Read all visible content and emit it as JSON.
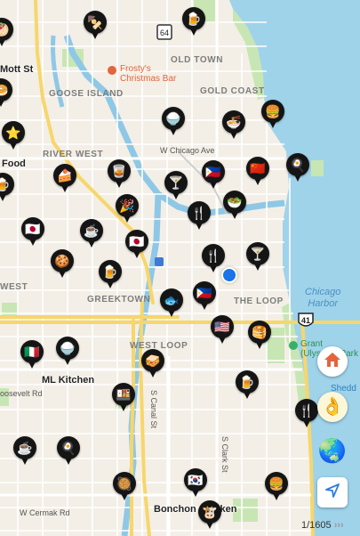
{
  "neighborhoods": {
    "old_town": "OLD TOWN",
    "gold_coast": "GOLD COAST",
    "goose_island": "GOOSE ISLAND",
    "river_west": "RIVER WEST",
    "greektown": "GREEKTOWN",
    "the_loop": "THE LOOP",
    "west_loop": "WEST LOOP",
    "west": "WEST"
  },
  "streets": {
    "chicago_ave": "W Chicago Ave",
    "roosevelt": "oosevelt Rd",
    "cermak": "W Cermak Rd",
    "canal": "S Canal St",
    "clark": "S Clark St",
    "mott": "Mott St"
  },
  "water": {
    "chicago_harbor": "Chicago\nHarbor"
  },
  "poi": {
    "frostys": "Frosty's\nChristmas Bar",
    "grant_park": "Grant\n(Ulysses) Park",
    "shedd": "Shedd"
  },
  "places": {
    "food": "Food",
    "ml_kitchen": "ML Kitchen",
    "bonchon": "Bonchon Chicken"
  },
  "shields": {
    "us41": "41",
    "i64": "64"
  },
  "counter": "1/1605",
  "counter_arrows": "›››",
  "icons": {
    "home": "home-icon",
    "okay_hand": "ok-hand-icon",
    "globe": "globe-icon",
    "location": "location-arrow-icon",
    "map_pin": "food-map-pin-icon",
    "poi_marker": "poi-marker-icon"
  },
  "pins": [
    {
      "emoji": "🥙"
    },
    {
      "emoji": "🍢"
    },
    {
      "emoji": "🍺"
    },
    {
      "emoji": "🥯"
    },
    {
      "emoji": "⭐"
    },
    {
      "emoji": "🍚"
    },
    {
      "emoji": "🍜"
    },
    {
      "emoji": "🍔"
    },
    {
      "emoji": "🍺"
    },
    {
      "emoji": "🍰"
    },
    {
      "emoji": "🥃"
    },
    {
      "emoji": "🍸"
    },
    {
      "emoji": "🇵🇭"
    },
    {
      "emoji": "🇨🇳"
    },
    {
      "emoji": "🍳"
    },
    {
      "emoji": "🥗"
    },
    {
      "emoji": "🇯🇵"
    },
    {
      "emoji": "☕"
    },
    {
      "emoji": "🎉"
    },
    {
      "emoji": "🍴"
    },
    {
      "emoji": "🇯🇵"
    },
    {
      "emoji": "🍪"
    },
    {
      "emoji": "🍺"
    },
    {
      "emoji": "🍴"
    },
    {
      "emoji": "🍸"
    },
    {
      "emoji": "🇵🇭"
    },
    {
      "emoji": "🐟"
    },
    {
      "emoji": "🇺🇸"
    },
    {
      "emoji": "🥞"
    },
    {
      "emoji": "🇮🇹"
    },
    {
      "emoji": "🍚"
    },
    {
      "emoji": "🥪"
    },
    {
      "emoji": "🍺"
    },
    {
      "emoji": "🍱"
    },
    {
      "emoji": "🍴"
    },
    {
      "emoji": "☕"
    },
    {
      "emoji": "🍳"
    },
    {
      "emoji": "🥘"
    },
    {
      "emoji": "🇰🇷"
    },
    {
      "emoji": "🍔"
    },
    {
      "emoji": "🐮"
    }
  ]
}
